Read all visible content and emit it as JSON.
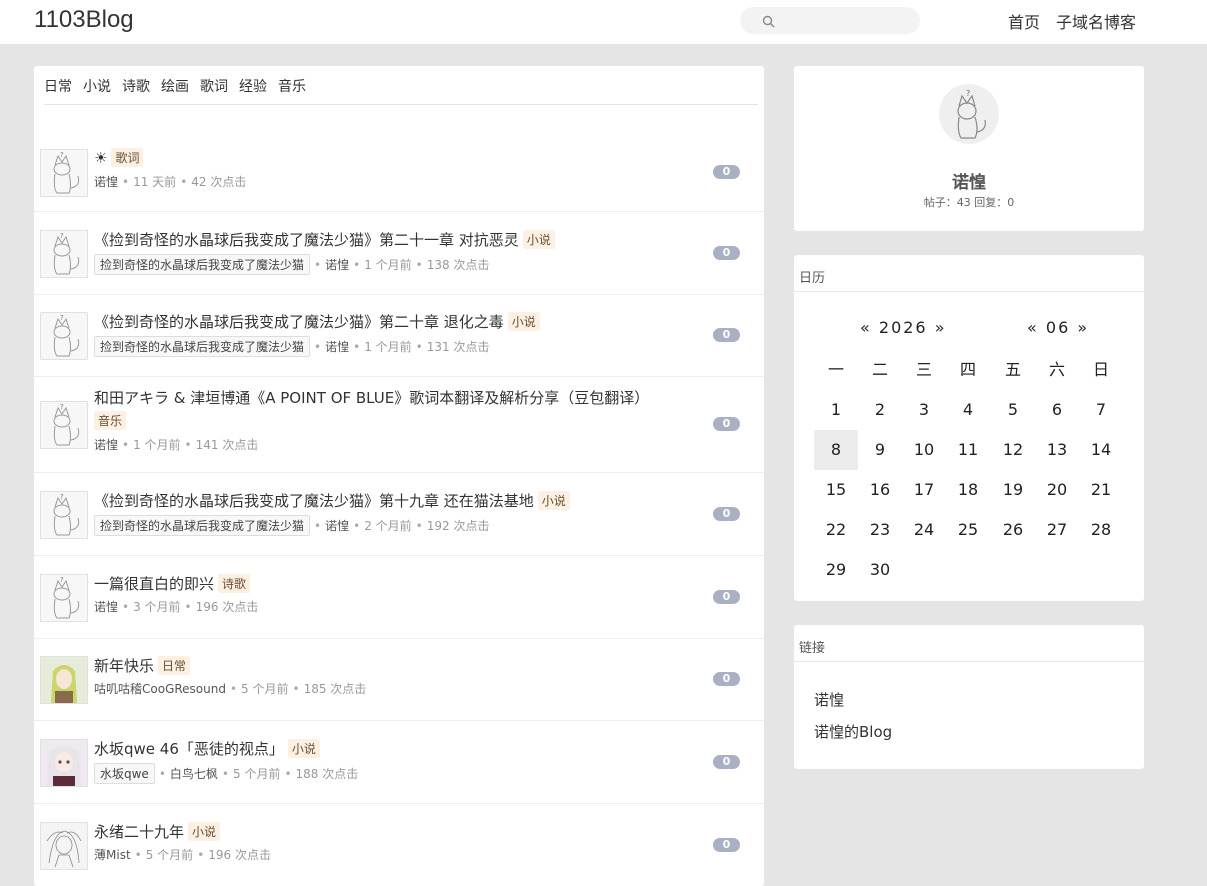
{
  "header": {
    "brand": "1103Blog",
    "search_placeholder": "",
    "nav": [
      "首页",
      "子域名博客"
    ]
  },
  "categories": [
    "日常",
    "小说",
    "诗歌",
    "绘画",
    "歌词",
    "经验",
    "音乐"
  ],
  "posts": [
    {
      "title": "☀",
      "category": "歌词",
      "series": "",
      "author": "诺惶",
      "time": "11 天前",
      "clicks": "42 次点击",
      "replies": "0",
      "avatar": "cat-sketch"
    },
    {
      "title": "《捡到奇怪的水晶球后我变成了魔法少猫》第二十一章 对抗恶灵",
      "category": "小说",
      "series": "捡到奇怪的水晶球后我变成了魔法少猫",
      "author": "诺惶",
      "time": "1 个月前",
      "clicks": "138 次点击",
      "replies": "0",
      "avatar": "cat-sketch"
    },
    {
      "title": "《捡到奇怪的水晶球后我变成了魔法少猫》第二十章 退化之毒",
      "category": "小说",
      "series": "捡到奇怪的水晶球后我变成了魔法少猫",
      "author": "诺惶",
      "time": "1 个月前",
      "clicks": "131 次点击",
      "replies": "0",
      "avatar": "cat-sketch"
    },
    {
      "title": "和田アキラ & 津垣博通《A POINT OF BLUE》歌词本翻译及解析分享（豆包翻译）",
      "category": "音乐",
      "series": "",
      "author": "诺惶",
      "time": "1 个月前",
      "clicks": "141 次点击",
      "replies": "0",
      "avatar": "cat-sketch"
    },
    {
      "title": "《捡到奇怪的水晶球后我变成了魔法少猫》第十九章 还在猫法基地",
      "category": "小说",
      "series": "捡到奇怪的水晶球后我变成了魔法少猫",
      "author": "诺惶",
      "time": "2 个月前",
      "clicks": "192 次点击",
      "replies": "0",
      "avatar": "cat-sketch"
    },
    {
      "title": "一篇很直白的即兴",
      "category": "诗歌",
      "series": "",
      "author": "诺惶",
      "time": "3 个月前",
      "clicks": "196 次点击",
      "replies": "0",
      "avatar": "cat-sketch"
    },
    {
      "title": "新年快乐",
      "category": "日常",
      "series": "",
      "author": "咕叽咕稽CooGResound",
      "time": "5 个月前",
      "clicks": "185 次点击",
      "replies": "0",
      "avatar": "anime-green"
    },
    {
      "title": "水坂qwe 46「恶徒的视点」",
      "category": "小说",
      "series": "水坂qwe",
      "author": "白鸟七枫",
      "time": "5 个月前",
      "clicks": "188 次点击",
      "replies": "0",
      "avatar": "anime-white"
    },
    {
      "title": "永绪二十九年",
      "category": "小说",
      "series": "",
      "author": "薄Mist",
      "time": "5 个月前",
      "clicks": "196 次点击",
      "replies": "0",
      "avatar": "sketch-grey"
    }
  ],
  "profile": {
    "name": "诺惶",
    "stats": "帖子：43 回复：0"
  },
  "calendar": {
    "title": "日历",
    "prev": "«",
    "next": "»",
    "year": "2026",
    "month": "06",
    "weekdays": [
      "一",
      "二",
      "三",
      "四",
      "五",
      "六",
      "日"
    ],
    "days": [
      "1",
      "2",
      "3",
      "4",
      "5",
      "6",
      "7",
      "8",
      "9",
      "10",
      "11",
      "12",
      "13",
      "14",
      "15",
      "16",
      "17",
      "18",
      "19",
      "20",
      "21",
      "22",
      "23",
      "24",
      "25",
      "26",
      "27",
      "28",
      "29",
      "30"
    ],
    "today": "8"
  },
  "links": {
    "title": "链接",
    "items": [
      "诺惶",
      "诺惶的Blog"
    ]
  }
}
